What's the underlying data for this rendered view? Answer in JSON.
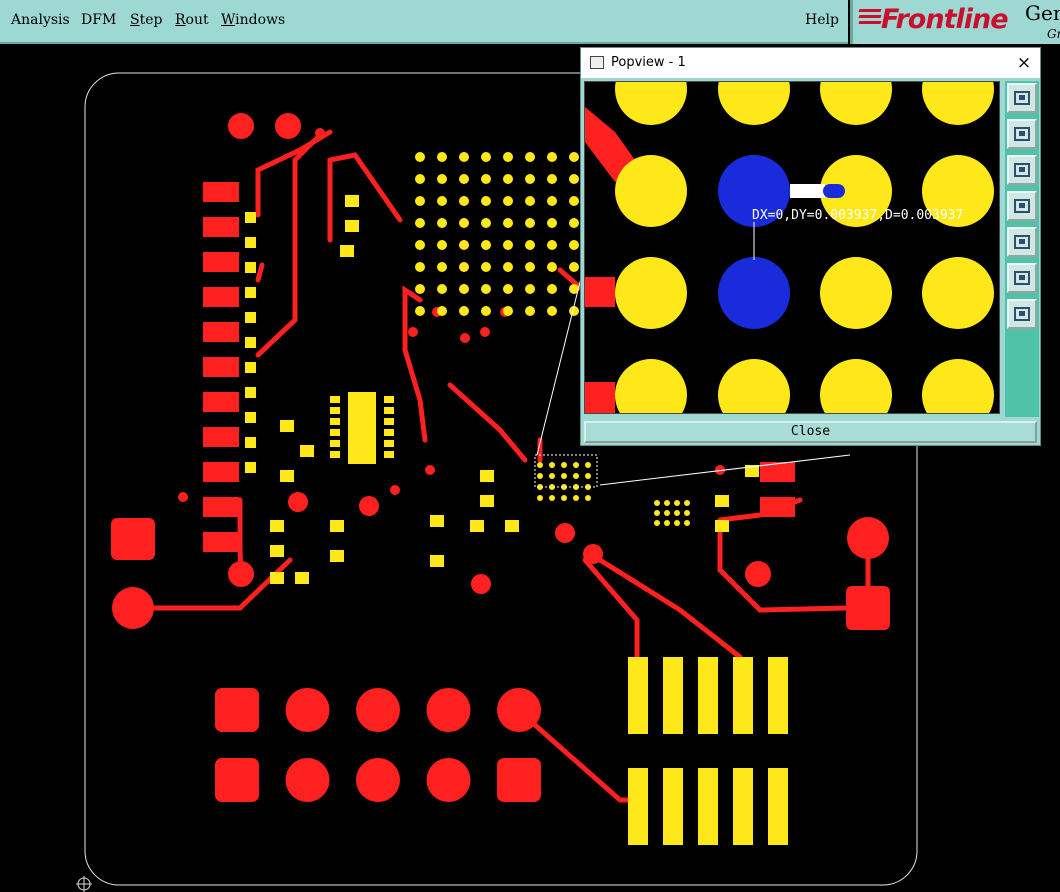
{
  "menu": {
    "items": [
      {
        "label": "Analysis"
      },
      {
        "label": "DFM"
      },
      {
        "label": "Step"
      },
      {
        "label": "Rout"
      },
      {
        "label": "Windows"
      }
    ],
    "help": "Help"
  },
  "brand": {
    "logo": "Frontline",
    "gen": "Gen",
    "gr": "Gr"
  },
  "popview": {
    "title": "Popview - 1",
    "close_symbol": "×",
    "measurement": "DX=0,DY=0.003937,D=0.003937",
    "close_label": "Close"
  },
  "colors": {
    "background": "#000000",
    "copper": "#ff2020",
    "pad": "#ffe81a",
    "highlight": "#1a2bdc",
    "menubar": "#9ed8d2",
    "brand": "#c8102e",
    "toolbar": "#4fc2a8"
  }
}
